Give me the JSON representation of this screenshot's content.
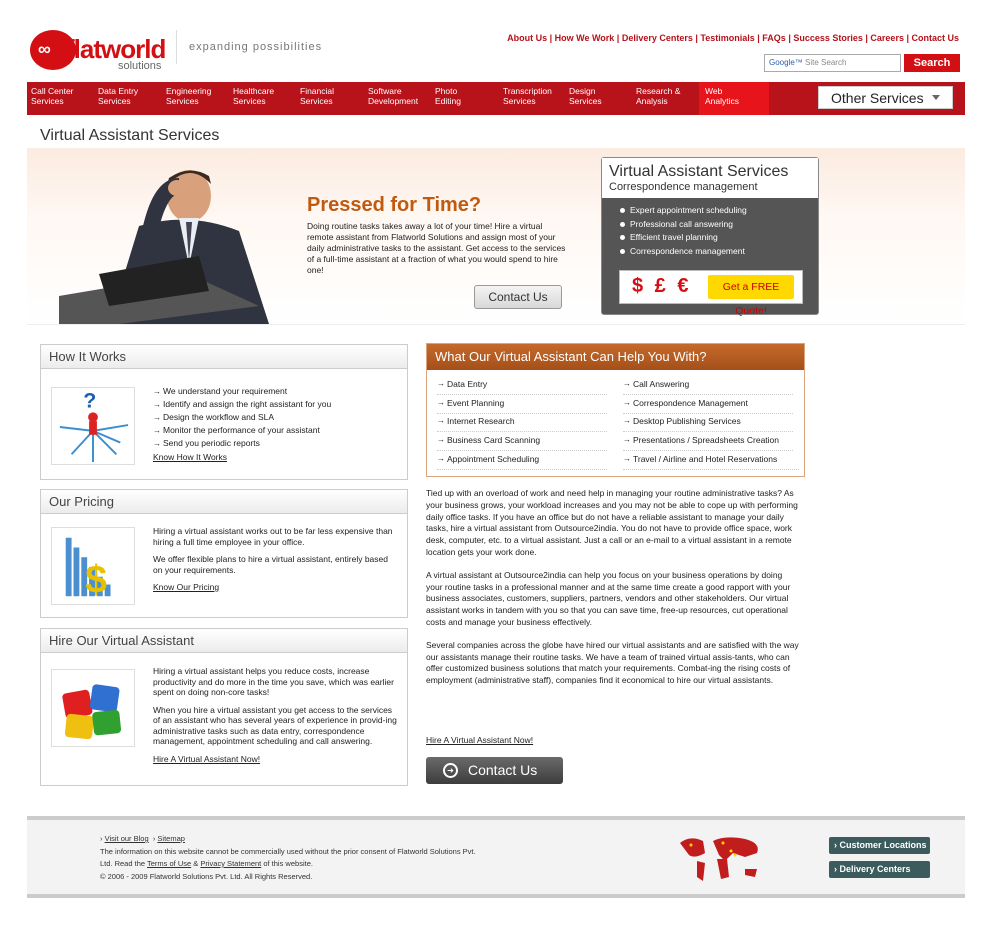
{
  "header": {
    "brand": "flatworld",
    "brand_sub": "solutions",
    "tagline": "expanding possibilities",
    "top_links": [
      "About Us",
      "How We Work",
      "Delivery Centers",
      "Testimonials",
      "FAQs",
      "Success Stories",
      "Careers",
      "Contact Us"
    ],
    "search_placeholder": "Site Search",
    "search_brand": "Google™",
    "search_button": "Search"
  },
  "nav": {
    "items": [
      {
        "line1": "Call Center",
        "line2": "Services"
      },
      {
        "line1": "Data Entry",
        "line2": "Services"
      },
      {
        "line1": "Engineering",
        "line2": "Services"
      },
      {
        "line1": "Healthcare",
        "line2": "Services"
      },
      {
        "line1": "Financial",
        "line2": "Services"
      },
      {
        "line1": "Software",
        "line2": "Development"
      },
      {
        "line1": "Photo",
        "line2": "Editing"
      },
      {
        "line1": "Transcription",
        "line2": "Services"
      },
      {
        "line1": "Design",
        "line2": "Services"
      },
      {
        "line1": "Research &",
        "line2": "Analysis"
      },
      {
        "line1": "Web",
        "line2": "Analytics"
      }
    ],
    "other_services": "Other Services"
  },
  "page_title": "Virtual Assistant Services",
  "banner": {
    "heading": "Pressed for Time?",
    "text": "Doing routine tasks takes away a lot of your time! Hire a virtual remote assistant from Flatworld Solutions and assign most of your daily administrative tasks to the assistant. Get access to the services of a full-time assistant at a fraction of what you would spend to hire one!",
    "contact_button": "Contact Us",
    "box_title": "Virtual Assistant Services",
    "box_subtitle": "Correspondence management",
    "box_items": [
      "Expert appointment scheduling",
      "Professional call answering",
      "Efficient travel planning",
      "Correspondence management"
    ],
    "currency": "$ £ €",
    "quote_button": "Get a FREE Quote!"
  },
  "how_it_works": {
    "title": "How It Works",
    "items": [
      "We understand your requirement",
      "Identify and assign the right assistant for you",
      "Design the workflow and SLA",
      "Monitor the performance of your assistant",
      "Send you periodic reports"
    ],
    "link": "Know How It Works"
  },
  "pricing": {
    "title": "Our Pricing",
    "p1": "Hiring a virtual assistant works out to be far less expensive than hiring a full time employee in your office.",
    "p2": "We offer flexible plans to hire a virtual assistant, entirely based on your requirements.",
    "link": "Know Our Pricing"
  },
  "hire": {
    "title": "Hire Our Virtual Assistant",
    "p1": "Hiring a virtual assistant helps you reduce costs, increase productivity and do more in the time you save, which was earlier spent on doing non-core tasks!",
    "p2": "When you hire a virtual assistant you get access to the services of an assistant who has several years of experience in provid-ing administrative tasks such as data entry, correspondence management, appointment scheduling and call answering.",
    "link": "Hire A Virtual Assistant Now!"
  },
  "help": {
    "title": "What Our Virtual Assistant Can Help You With?",
    "left": [
      "Data Entry",
      "Event Planning",
      "Internet Research",
      "Business Card Scanning",
      "Appointment Scheduling"
    ],
    "right": [
      "Call Answering",
      "Correspondence Management",
      "Desktop Publishing Services",
      "Presentations / Spreadsheets Creation",
      "Travel / Airline and Hotel Reservations"
    ]
  },
  "main": {
    "p1": "Tied up with an overload of work and need help in managing your routine administrative tasks? As your business grows, your workload increases and you may not be able to cope up with performing daily office tasks. If you have an office but do not have a reliable assistant to manage your daily tasks, hire a virtual assistant from Outsource2india. You do not have to provide office space, work desk, computer, etc. to a virtual assistant. Just a call or an e-mail to a virtual assistant in a remote location gets your work done.",
    "p2": "A virtual assistant at Outsource2india can help you focus on your business operations by doing your routine tasks in a professional manner and at the same time create a good rapport with your business associates, customers, suppliers, partners, vendors and other stakeholders. Our virtual assistant works in tandem with you so that you can save time, free-up resources, cut operational costs and manage your business effectively.",
    "p3": "Several companies across the globe have hired our virtual assistants and are satisfied with the way our assistants manage their routine tasks. We have a team of trained virtual assis-tants, who can offer customized business solutions that match your requirements. Combat-ing the rising costs of employment (administrative staff), companies find it economical to hire our virtual assistants.",
    "link": "Hire A Virtual Assistant Now!",
    "contact": "Contact Us"
  },
  "footer": {
    "blog": "Visit our Blog",
    "sitemap": "Sitemap",
    "line1": "The information on this website cannot be commercially used without the prior consent of Flatworld Solutions Pvt.",
    "line2a": "Ltd. Read the",
    "terms": "Terms of Use",
    "amp": "&",
    "privacy": "Privacy Statement",
    "line2b": "of this website.",
    "copyright": "© 2006 - 2009 Flatworld Solutions Pvt. Ltd. All Rights Reserved.",
    "btn1": "Customer Locations",
    "btn2": "Delivery Centers"
  }
}
